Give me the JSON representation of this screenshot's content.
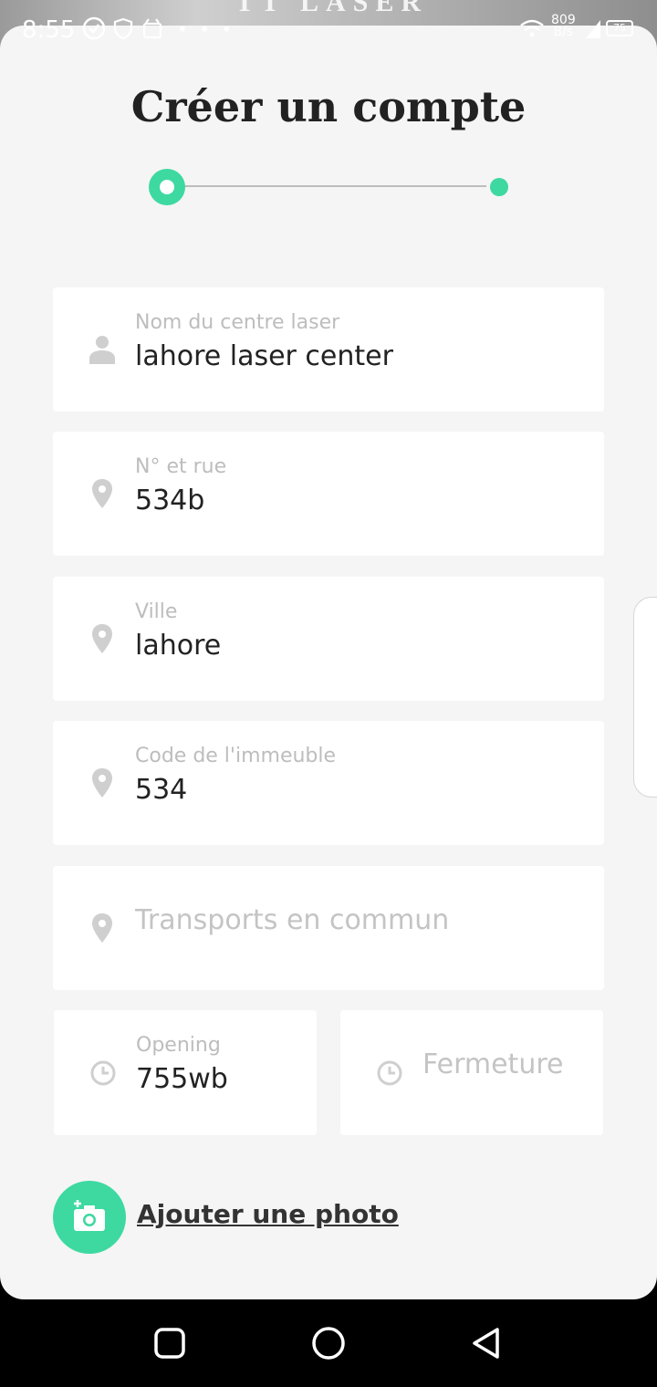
{
  "status_bar": {
    "time": "8:55",
    "dots": "• • •",
    "net_speed_value": "809",
    "net_speed_unit": "B/s",
    "battery": "75",
    "background_text": "TT LASER"
  },
  "page": {
    "title": "Créer un compte"
  },
  "stepper": {
    "steps": 2,
    "current": 1,
    "accent": "#3dd9a0"
  },
  "form": {
    "center_name": {
      "label": "Nom du centre laser",
      "value": "lahore laser center",
      "icon": "person-icon"
    },
    "street": {
      "label": "N° et rue",
      "value": "534b",
      "icon": "location-pin-icon"
    },
    "city": {
      "label": "Ville",
      "value": "lahore",
      "icon": "location-pin-icon"
    },
    "building_code": {
      "label": "Code de l'immeuble",
      "value": "534",
      "icon": "location-pin-icon"
    },
    "transport": {
      "placeholder": "Transports en commun",
      "icon": "location-pin-icon"
    },
    "opening": {
      "label": "Opening",
      "value": "755wb",
      "icon": "clock-icon"
    },
    "closing": {
      "placeholder": "Fermeture",
      "icon": "clock-icon"
    }
  },
  "actions": {
    "add_photo_label": "Ajouter une photo",
    "add_photo_icon": "add-camera-icon"
  },
  "nav": {
    "recent": "recent-apps-icon",
    "home": "home-icon",
    "back": "back-icon"
  }
}
